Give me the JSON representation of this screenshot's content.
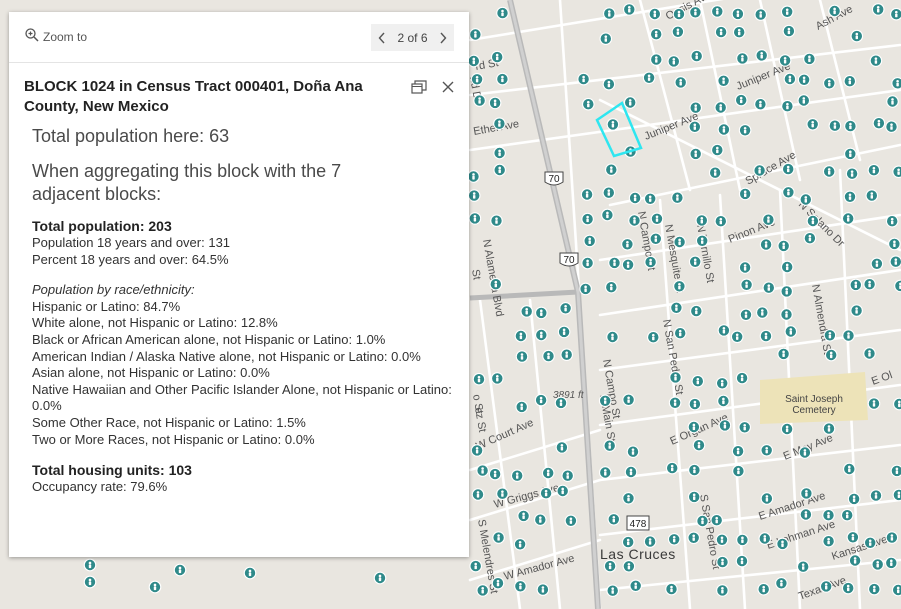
{
  "map": {
    "streets": [
      "Oasis Ave",
      "Ash Ave",
      "Juniper Ave",
      "Juniper Ave",
      "Ethel Ave",
      "Spruce Ave",
      "N Solano Dr",
      "Pinon Ave",
      "N Almendra St",
      "N Tornillo St",
      "N Mesquite St",
      "N Campo St",
      "N Alameda Blvd",
      "N San Pedro St",
      "N Campo St",
      "N Main St",
      "E Organ Ave",
      "E May Ave",
      "E Amador Ave",
      "E Lohman Ave",
      "Kansas Ave",
      "Texas Ave",
      "W Court Ave",
      "W Griggs Ave",
      "W Amador Ave",
      "S Melendres St",
      "S San Pedro St",
      "E Ol"
    ],
    "route_70_a": "70",
    "route_70_b": "70",
    "route_478": "478",
    "elevation": "3891 ft",
    "city": "Las Cruces",
    "cemetery": "Saint Joseph\nCemetery",
    "partial_labels": [
      "nd Dr",
      "rd St",
      "o St",
      "ez St",
      "St"
    ],
    "colors": {
      "marker": "#2f8a8a",
      "selection": "#2ee6f0",
      "road": "#ffffff",
      "highway": "#bdbdbd",
      "park": "#ede3b8",
      "land": "#e9e6e0"
    },
    "marker_icon": "person-pin-icon"
  },
  "popup": {
    "zoom_label": "Zoom to",
    "pager": "2 of 6",
    "title": "BLOCK 1024 in Census Tract 000401, Doña Ana County, New Mexico",
    "total_here": "Total population here: 63",
    "aggregate_note": "When aggregating this block with the 7 adjacent blocks:",
    "total_pop": "Total population: 203",
    "pop18": "Population 18 years and over: 131",
    "pct18": "Percent 18 years and over: 64.5%",
    "race_heading": "Population by race/ethnicity:",
    "race": [
      "Hispanic or Latino: 84.7%",
      "White alone, not Hispanic or Latino: 12.8%",
      "Black or African American alone, not Hispanic or Latino: 1.0%",
      "American Indian / Alaska Native alone, not Hispanic or Latino: 0.0%",
      "Asian alone, not Hispanic or Latino: 0.0%",
      "Native Hawaiian and Other Pacific Islander Alone, not Hispanic or Latino: 0.0%",
      "Some Other Race, not Hispanic or Latino: 1.5%",
      "Two or More Races, not Hispanic or Latino: 0.0%"
    ],
    "housing": "Total housing units: 103",
    "occupancy": "Occupancy rate: 79.6%"
  }
}
